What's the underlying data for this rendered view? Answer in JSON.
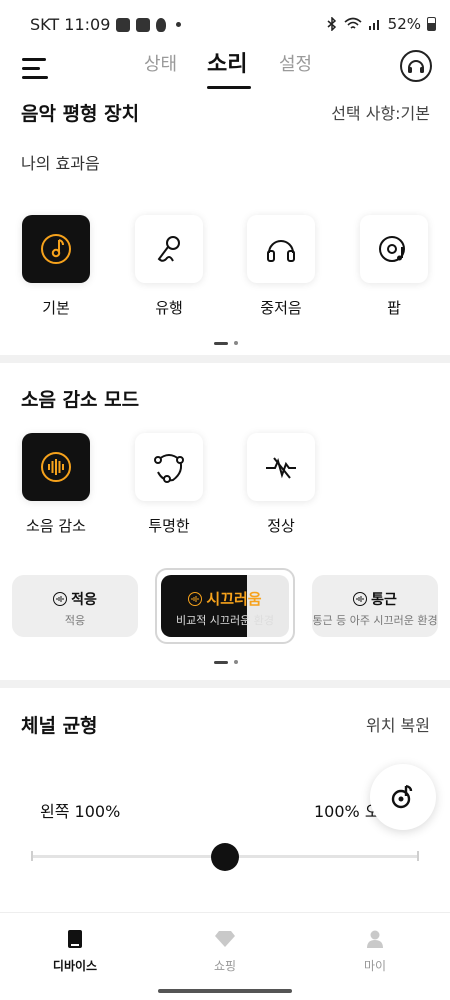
{
  "status_bar": {
    "carrier_time": "SKT 11:09",
    "battery": "52%"
  },
  "nav": {
    "tabs": [
      "상태",
      "소리",
      "설정"
    ],
    "active_tab": "소리"
  },
  "equalizer": {
    "title": "음악 평형 장치",
    "selection": "선택 사항:기본",
    "subtitle": "나의 효과음",
    "presets": [
      {
        "label": "기본",
        "icon": "music-disc-icon",
        "selected": true
      },
      {
        "label": "유행",
        "icon": "microphone-icon",
        "selected": false
      },
      {
        "label": "중저음",
        "icon": "headphones-icon",
        "selected": false
      },
      {
        "label": "팝",
        "icon": "vinyl-music-icon",
        "selected": false
      }
    ]
  },
  "noise": {
    "title": "소음 감소 모드",
    "modes": [
      {
        "label": "소음 감소",
        "icon": "noise-cancel-icon",
        "selected": true
      },
      {
        "label": "투명한",
        "icon": "transparency-icon",
        "selected": false
      },
      {
        "label": "정상",
        "icon": "normal-mode-icon",
        "selected": false
      }
    ],
    "levels": [
      {
        "title": "적응",
        "subtitle": "적응"
      },
      {
        "title": "시끄러움",
        "subtitle": "비교적 시끄러운 환경"
      },
      {
        "title": "통근",
        "subtitle": "통근 등 아주 시끄러운 환경"
      }
    ],
    "active_level": "시끄러움"
  },
  "balance": {
    "title": "체널 균형",
    "reset": "위치 복원",
    "left_label": "왼쪽 100%",
    "right_label": "100% 오",
    "position": 0.5
  },
  "bottom_nav": {
    "items": [
      {
        "label": "디바이스",
        "active": true
      },
      {
        "label": "쇼핑",
        "active": false
      },
      {
        "label": "마이",
        "active": false
      }
    ]
  },
  "colors": {
    "accent": "#f6a21c",
    "dark_card": "#111111"
  }
}
